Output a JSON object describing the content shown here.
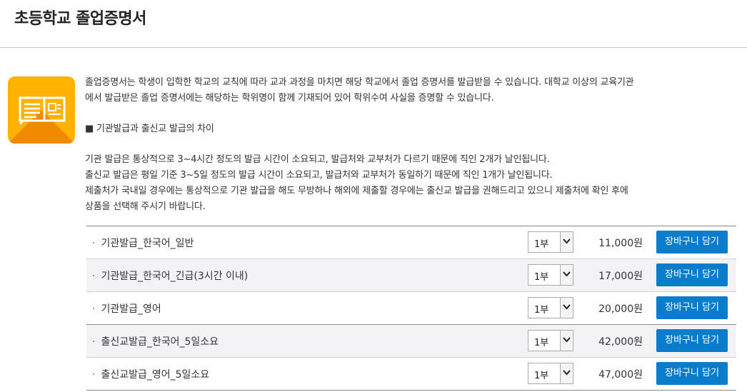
{
  "page_title": "초등학교 졸업증명서",
  "description": {
    "line1": "졸업증명서는 학생이 입학한 학교의 교칙에 따라 교과 과정을 마치면 해당 학교에서 졸업 증명서를 발급받을 수 있습니다. 대학교 이상의 교육기관",
    "line2": "에서 발급받은 졸업 증명서에는 해당하는 학위명이 함께 기재되어 있어 학위수여 사실을 증명할 수 있습니다.",
    "section_heading": "■ 기관발급과 출신교 발급의 차이",
    "line3": "기관 발급은 통상적으로 3~4시간 정도의 발급 시간이 소요되고, 발급처와 교부처가 다르기 때문에 직인 2개가 날인됩니다.",
    "line4": "출신교 발급은 평일 기준 3~5일 정도의 발급 시간이 소요되고, 발급처와 교부처가 동일하기 때문에 직인 1개가 날인됩니다.",
    "line5": "제출처가 국내일 경우에는 통상적으로 기관 발급을 해도 무방하나 해외에 제출할 경우에는 출신교 발급을 권해드리고 있으니 제출처에 확인 후에",
    "line6": "상품을 선택해 주시기 바랍니다."
  },
  "products": [
    {
      "name": "기관발급_한국어_일반",
      "qty": "1부",
      "price": "11,000원",
      "button": "장바구니 담기"
    },
    {
      "name": "기관발급_한국어_긴급(3시간 이내)",
      "qty": "1부",
      "price": "17,000원",
      "button": "장바구니 담기"
    },
    {
      "name": "기관발급_영어",
      "qty": "1부",
      "price": "20,000원",
      "button": "장바구니 담기"
    },
    {
      "name": "출신교발급_한국어_5일소요",
      "qty": "1부",
      "price": "42,000원",
      "button": "장바구니 담기"
    },
    {
      "name": "출신교발급_영어_5일소요",
      "qty": "1부",
      "price": "47,000원",
      "button": "장바구니 담기"
    }
  ],
  "bullet": "·",
  "colors": {
    "accent": "#0a7ccc",
    "icon_bg": "#ffb300",
    "icon_shadow": "#f28a00"
  },
  "icons": {
    "document": "document-icon",
    "dropdown": "chevron-down-icon"
  }
}
